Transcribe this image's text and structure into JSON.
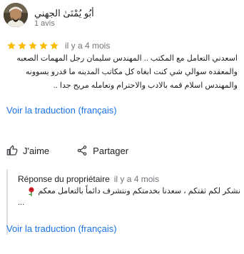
{
  "review": {
    "reviewer_name": "أبُو يُمْنَىٰ الجهني",
    "reviewer_meta": "1 avis",
    "rating": 5,
    "rating_max": 5,
    "date": "il y a 4 mois",
    "text_lines": [
      "اسعدني التعامل مع المكتب .. المهندس سليمان رجل المهمات الصعبه",
      "والمعقده سوالي شي كنت ابغاه كل مكاتب المدينه ما قدرو يسوونه",
      "والمهندس اسلام قمه بالادب والاحترام وتعامله مريح جدا .."
    ],
    "translate_label": "Voir la traduction (français)",
    "star_color": "#fbbc04"
  },
  "actions": {
    "like_label": "J'aime",
    "share_label": "Partager"
  },
  "owner_reply": {
    "title": "Réponse du propriétaire",
    "date": "il y a 4 mois",
    "text_line1": "نشكر لكم ثقتكم ، سعدنا بخدمتكم ونتشرف دائماً بالتعامل معكم",
    "text_line2": "...",
    "translate_label": "Voir la traduction (français)"
  },
  "icons": {
    "like": "thumbs-up-icon",
    "share": "share-icon",
    "star": "star-icon",
    "rose": "rose-emoji-icon"
  },
  "colors": {
    "link": "#1a73e8",
    "secondary_text": "#70757a",
    "reply_border": "#dadce0"
  }
}
